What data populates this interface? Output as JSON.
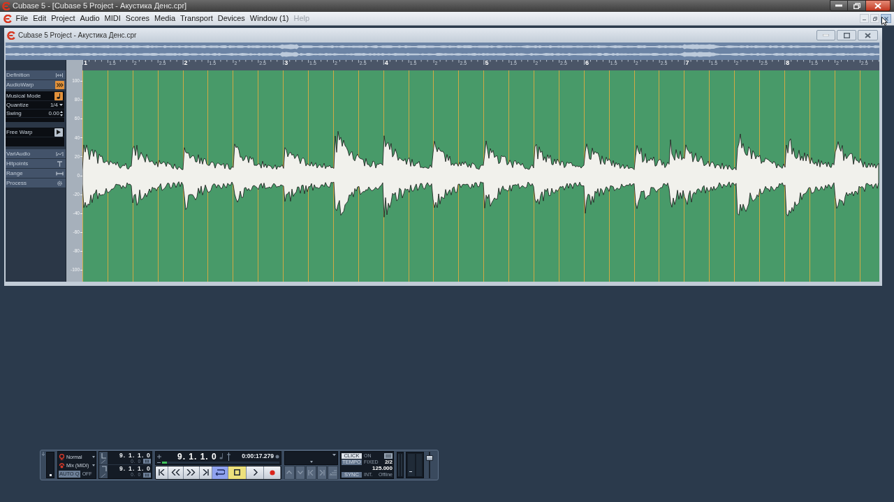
{
  "app_window": {
    "title": "Cubase 5 - [Cubase 5 Project - Акустика Денс.cpr]"
  },
  "menu": [
    {
      "label": "File",
      "disabled": false
    },
    {
      "label": "Edit",
      "disabled": false
    },
    {
      "label": "Project",
      "disabled": false
    },
    {
      "label": "Audio",
      "disabled": false
    },
    {
      "label": "MIDI",
      "disabled": false
    },
    {
      "label": "Scores",
      "disabled": false
    },
    {
      "label": "Media",
      "disabled": false
    },
    {
      "label": "Transport",
      "disabled": false
    },
    {
      "label": "Devices",
      "disabled": false
    },
    {
      "label": "Window (1)",
      "disabled": false
    },
    {
      "label": "Help",
      "disabled": true
    }
  ],
  "project_window": {
    "title": "Cubase 5 Project - Акустика Денс.cpr",
    "inspector": [
      {
        "label": "Definition",
        "active": false
      },
      {
        "label": "AudioWarp",
        "active": true,
        "panels": [
          [
            {
              "kind": "toggle",
              "label": "Musical Mode",
              "on": true
            },
            {
              "kind": "dropdown",
              "label": "Quantize",
              "value": "1/4"
            },
            {
              "kind": "number",
              "label": "Swing",
              "value": "0.00"
            }
          ],
          [
            {
              "kind": "toggle",
              "label": "Free Warp",
              "on": false
            }
          ]
        ]
      },
      {
        "label": "VariAudio",
        "active": false
      },
      {
        "label": "Hitpoints",
        "active": false
      },
      {
        "label": "Range",
        "active": false
      },
      {
        "label": "Process",
        "active": false
      }
    ],
    "level_scale": [
      "100",
      "80",
      "60",
      "40",
      "20",
      "0",
      "-20",
      "-40",
      "-60",
      "-80",
      "-100"
    ],
    "ruler": [
      {
        "bar": "1",
        "beats": [
          "1.5",
          "2",
          "2.5"
        ]
      },
      {
        "bar": "2",
        "beats": [
          "1.5",
          "2",
          "2.5"
        ]
      },
      {
        "bar": "3",
        "beats": [
          "1.5",
          "2",
          "2.5"
        ]
      },
      {
        "bar": "4",
        "beats": [
          "1.5",
          "2",
          "2.5"
        ]
      },
      {
        "bar": "5",
        "beats": [
          "1.5",
          "2",
          "2.5"
        ]
      },
      {
        "bar": "6",
        "beats": [
          "1.5",
          "2",
          "2.5"
        ]
      },
      {
        "bar": "7",
        "beats": [
          "1.5",
          "2",
          "2.5"
        ]
      },
      {
        "bar": "8",
        "beats": [
          "1.5",
          "2",
          "2.5"
        ]
      }
    ]
  },
  "transport": {
    "record_mode": "Normal",
    "cycle_record_mode": "Mix (MIDI)",
    "auto_quantize": {
      "label": "AUTO Q",
      "value": "OFF",
      "on": false
    },
    "locators": [
      {
        "position": "9. 1. 1. 0",
        "offset": "0. 0"
      },
      {
        "position": "9. 1. 1. 0",
        "offset": "0. 0"
      }
    ],
    "primary_time": "9. 1. 1. 0",
    "secondary_time": "0:00:17.279",
    "position": {
      "level": 0.04
    },
    "buttons": [
      {
        "kind": "start",
        "on": false
      },
      {
        "kind": "rewind",
        "on": false
      },
      {
        "kind": "forward",
        "on": false
      },
      {
        "kind": "end",
        "on": false
      },
      {
        "kind": "cycle",
        "on": true
      },
      {
        "kind": "stop",
        "on": true
      },
      {
        "kind": "play",
        "on": false
      },
      {
        "kind": "record",
        "on": false
      }
    ],
    "marker_buttons": [
      {
        "kind": "up",
        "disabled": true
      },
      {
        "kind": "down",
        "disabled": true
      },
      {
        "kind": "previous",
        "disabled": true
      },
      {
        "kind": "next",
        "disabled": true
      },
      {
        "kind": "add",
        "disabled": true
      }
    ],
    "click": {
      "label": "CLICK",
      "value": "ON",
      "on": true
    },
    "tempo": {
      "label": "TEMPO",
      "mode": "FIXED",
      "signature": "2/2",
      "value": "125.000"
    },
    "sync": {
      "label": "SYNC",
      "source": "INT.",
      "status": "Offline"
    },
    "master_volume": {
      "level": 0.85
    }
  }
}
